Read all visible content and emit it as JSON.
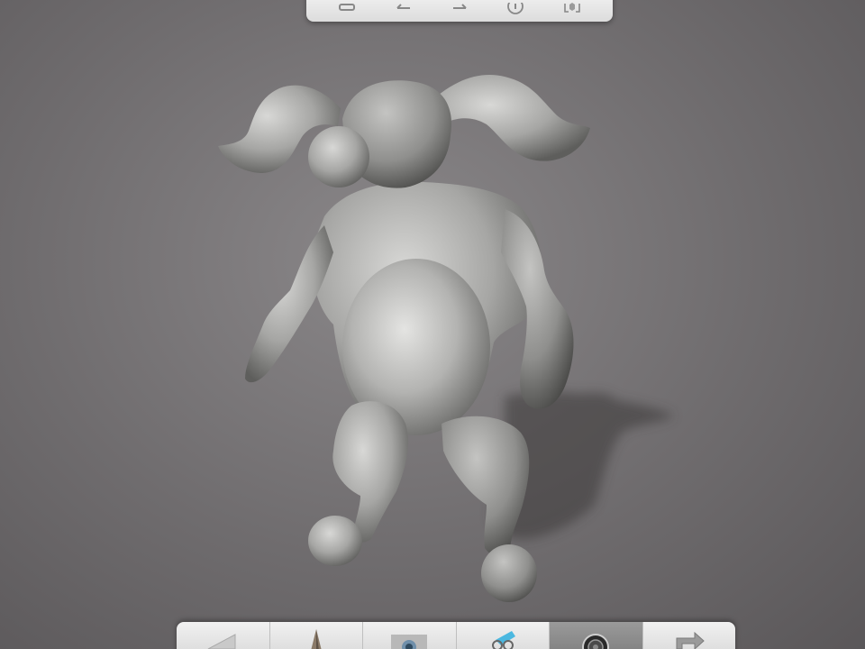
{
  "app": {
    "background_color": "#6f6c6e",
    "model_color": "#a9a9a7"
  },
  "top_toolbar": {
    "buttons": [
      {
        "name": "undo-button",
        "icon": "undo-arrow-icon"
      },
      {
        "name": "back-button",
        "icon": "arrow-left-icon"
      },
      {
        "name": "forward-button",
        "icon": "arrow-right-icon"
      },
      {
        "name": "info-button",
        "icon": "info-icon"
      },
      {
        "name": "view-button",
        "icon": "cube-frame-icon"
      }
    ]
  },
  "bottom_toolbar": {
    "tools": [
      {
        "name": "tool-triangle",
        "icon": "triangle-icon"
      },
      {
        "name": "tool-cone",
        "icon": "cone-icon"
      },
      {
        "name": "tool-sculpt",
        "icon": "sculpt-icon"
      },
      {
        "name": "tool-paint",
        "icon": "paint-icon"
      },
      {
        "name": "tool-camera",
        "icon": "camera-icon",
        "active": true
      },
      {
        "name": "tool-export",
        "icon": "share-arrow-icon"
      }
    ]
  }
}
